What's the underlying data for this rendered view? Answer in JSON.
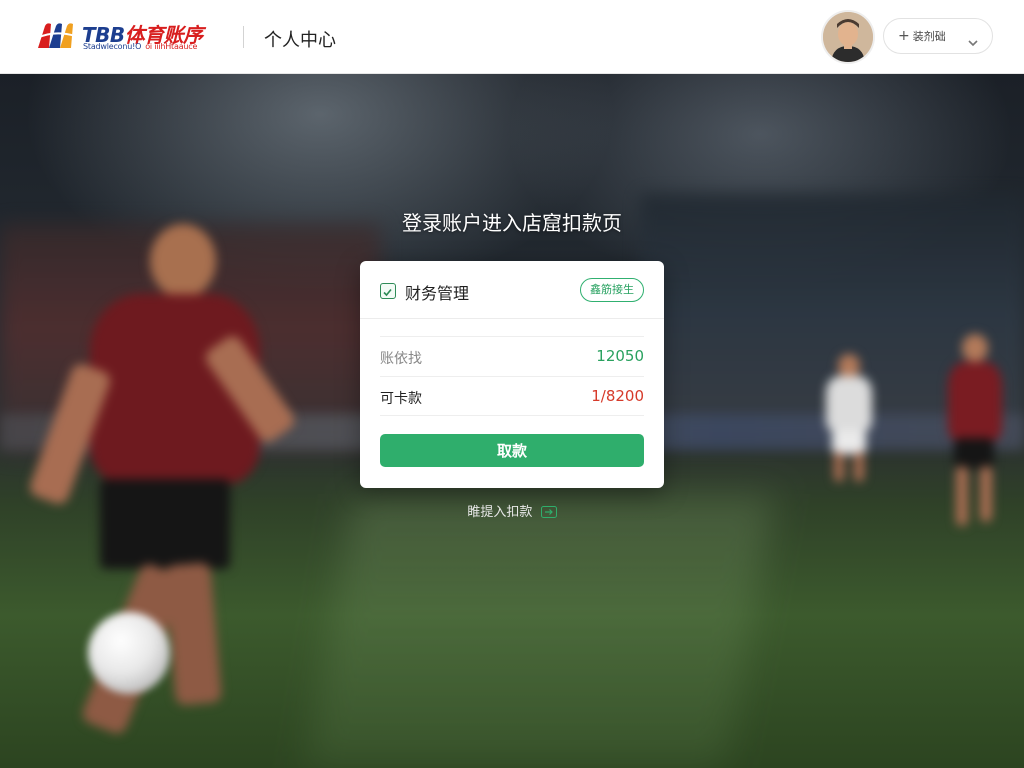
{
  "header": {
    "logo_title_first": "TBB",
    "logo_title_rest": "体育账序",
    "logo_sub_1": "Stadwleconu!O",
    "logo_sub_2": "oi  iiihHtaauce",
    "title": "个人中心",
    "user_plus": "+",
    "user_name": "装剂础",
    "user_dropdown_icon": "chevron-down-icon"
  },
  "main": {
    "heading": "登录账户进入店窟扣款页"
  },
  "card": {
    "title": "财务管理",
    "tag_label": "鑫筋接生",
    "rows": [
      {
        "label": "账依找",
        "value": "12050"
      },
      {
        "label": "可卡款",
        "value": "1/8200"
      }
    ],
    "button_label": "取款"
  },
  "footer": {
    "link_label": "睢提入扣款",
    "link_icon": "arrow-right-icon"
  },
  "colors": {
    "accent_green": "#2fae6c",
    "value_green": "#2aa15f",
    "value_red": "#d63a2a",
    "logo_red": "#d81e1e",
    "logo_blue": "#1d3e8f"
  }
}
